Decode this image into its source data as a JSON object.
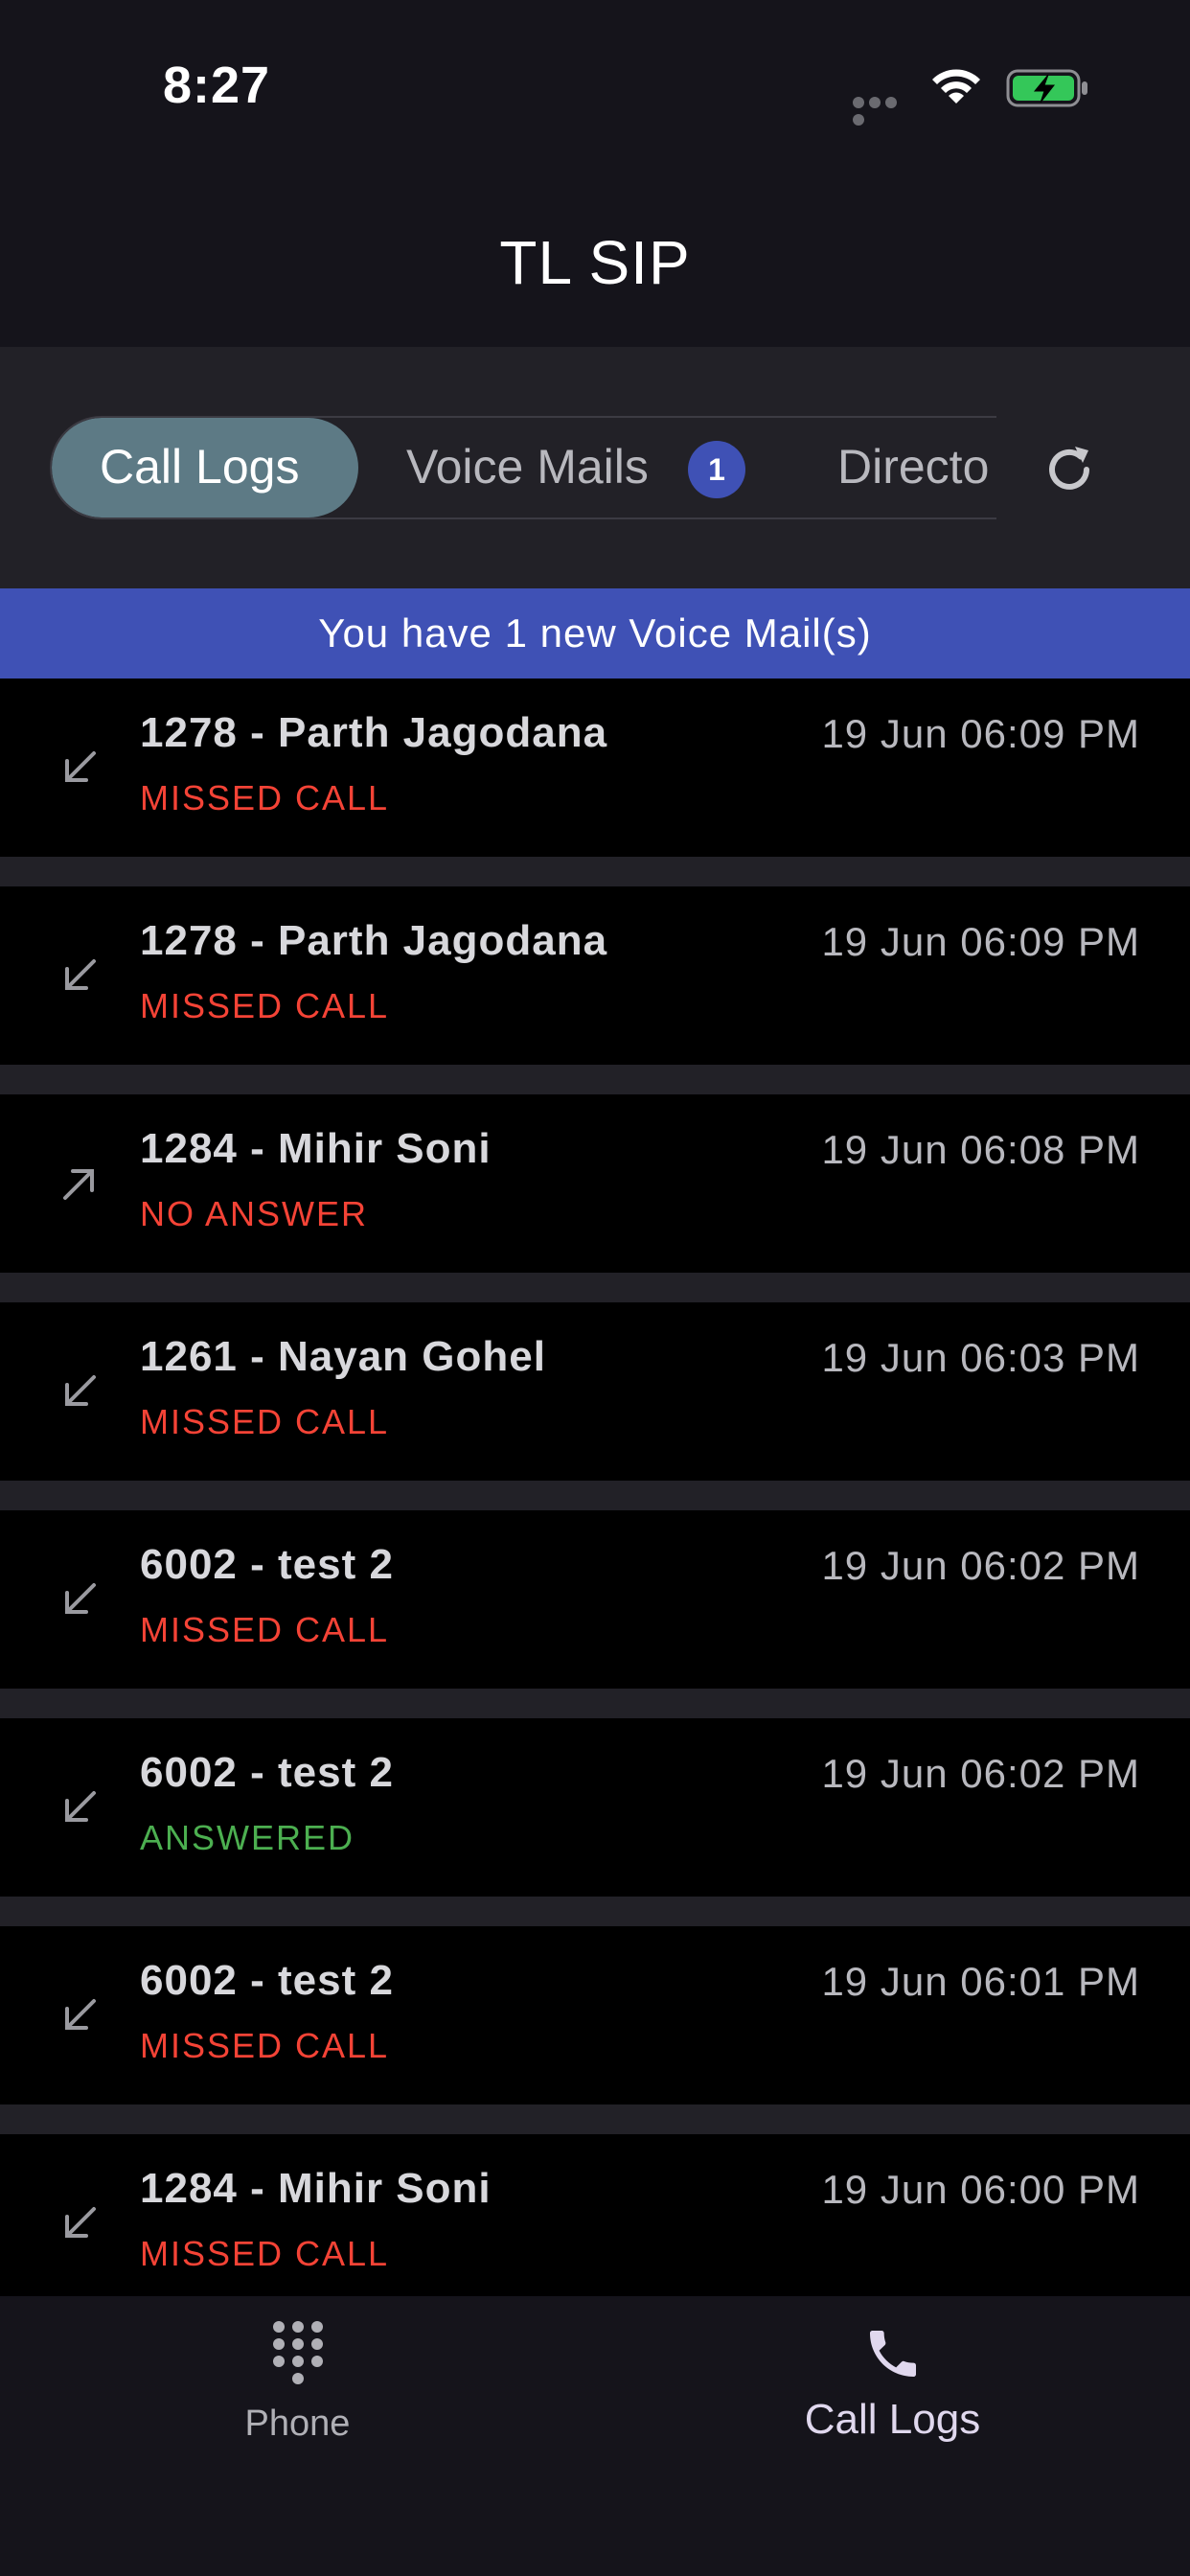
{
  "status_bar": {
    "time": "8:27",
    "icons": [
      "signal-icon",
      "wifi-icon",
      "battery-charging-icon"
    ]
  },
  "app": {
    "title": "TL SIP"
  },
  "tabs": {
    "items": [
      {
        "label": "Call Logs",
        "active": true
      },
      {
        "label": "Voice Mails",
        "badge": "1"
      },
      {
        "label": "Directo"
      }
    ],
    "refresh_icon": "refresh-icon"
  },
  "banner": {
    "text": "You have 1 new Voice Mail(s)"
  },
  "call_logs": [
    {
      "name": "1278 - Parth Jagodana",
      "status": "MISSED CALL",
      "time": "19 Jun 06:09 PM",
      "direction": "incoming"
    },
    {
      "name": "1278 - Parth Jagodana",
      "status": "MISSED CALL",
      "time": "19 Jun 06:09 PM",
      "direction": "incoming"
    },
    {
      "name": "1284 - Mihir Soni",
      "status": "NO ANSWER",
      "time": "19 Jun 06:08 PM",
      "direction": "outgoing"
    },
    {
      "name": "1261 - Nayan Gohel",
      "status": "MISSED CALL",
      "time": "19 Jun 06:03 PM",
      "direction": "incoming"
    },
    {
      "name": "6002 - test 2",
      "status": "MISSED CALL",
      "time": "19 Jun 06:02 PM",
      "direction": "incoming"
    },
    {
      "name": "6002 - test 2",
      "status": "ANSWERED",
      "time": "19 Jun 06:02 PM",
      "direction": "incoming"
    },
    {
      "name": "6002 - test 2",
      "status": "MISSED CALL",
      "time": "19 Jun 06:01 PM",
      "direction": "incoming"
    },
    {
      "name": "1284 - Mihir Soni",
      "status": "MISSED CALL",
      "time": "19 Jun 06:00 PM",
      "direction": "incoming"
    }
  ],
  "status_colors": {
    "MISSED CALL": "#f44336",
    "NO ANSWER": "#f44336",
    "ANSWERED": "#4caf50"
  },
  "bottom_nav": {
    "items": [
      {
        "label": "Phone",
        "icon": "dialpad-icon"
      },
      {
        "label": "Call Logs",
        "icon": "phone-icon",
        "active": true
      }
    ]
  }
}
